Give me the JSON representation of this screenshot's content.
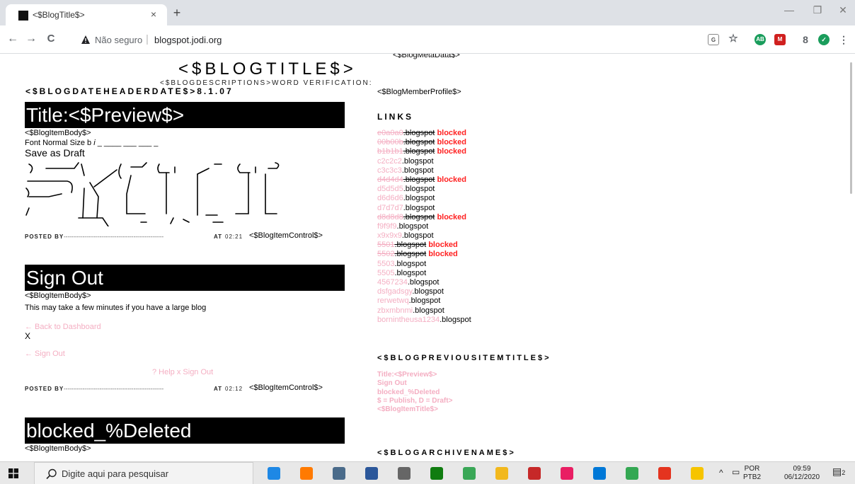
{
  "browser": {
    "tab_title": "<$BlogTitle$>",
    "tab_close": "×",
    "new_tab": "+",
    "window_min": "—",
    "window_restore": "❐",
    "window_close": "✕",
    "nav_back": "←",
    "nav_forward": "→",
    "nav_reload": "C",
    "security_label": "Não seguro",
    "url": "blogspot.jodi.org",
    "extensions": [
      {
        "name": "translate",
        "color": "#5f6368"
      },
      {
        "name": "bookmark-star",
        "color": "#5f6368"
      },
      {
        "name": "adblock",
        "color": "#1a9d5c",
        "label": "AB"
      },
      {
        "name": "red-extension",
        "color": "#d0201f"
      },
      {
        "name": "profile",
        "color": "#5f6368"
      },
      {
        "name": "shield",
        "color": "#1a9d5c"
      },
      {
        "name": "menu",
        "color": "#5f6368"
      }
    ]
  },
  "blog": {
    "meta_data": "<$BlogMetaData$>",
    "title": "<$BLOGTITLE$>",
    "description": "<$BLOGDESCRIPTIONS>WORD VERIFICATION:",
    "date_header": "<$BLOGDATEHEADERDATE$>8.1.07",
    "posts": [
      {
        "title": "Title:<$Preview$>",
        "body": "<$BlogItemBody$>",
        "font_line": "Font Normal Size b",
        "font_italic": "i",
        "font_underscores": " _ ____ ___ ___ _",
        "save_draft": "Save as Draft",
        "posted_by": "POSTED BY",
        "posted_dashes": "-----------------------------------------------------",
        "at": "AT",
        "time": "02:21",
        "control": "<$BlogItemControl$>"
      },
      {
        "title": "Sign Out",
        "body": "<$BlogItemBody$>",
        "text": "This may take a few minutes if you have a large blog",
        "back_link": "← Back to Dashboard",
        "x_mark": "X",
        "signout_link": "← Sign Out",
        "help_link": "? Help x Sign Out",
        "posted_by": "POSTED BY",
        "posted_dashes": "-----------------------------------------------------",
        "at": "AT",
        "time": "02:12",
        "control": "<$BlogItemControl$>"
      },
      {
        "title": "blocked_%Deleted",
        "body": "<$BlogItemBody$>"
      }
    ],
    "member_profile": "<$BlogMemberProfile$>",
    "links_heading": "LINKS",
    "links": [
      {
        "id": "e0a0a0",
        "suffix": ".blogspot",
        "blocked": "blocked"
      },
      {
        "id": "00b00b",
        "suffix": ".blogspot",
        "blocked": "blocked"
      },
      {
        "id": "b1b1b1",
        "suffix": ".blogspot",
        "blocked": "blocked"
      },
      {
        "id": "c2c2c2",
        "suffix": ".blogspot",
        "blocked": ""
      },
      {
        "id": "c3c3c3",
        "suffix": ".blogspot",
        "blocked": ""
      },
      {
        "id": "d4d4d4",
        "suffix": ".blogspot",
        "blocked": "blocked"
      },
      {
        "id": "d5d5d5",
        "suffix": ".blogspot",
        "blocked": ""
      },
      {
        "id": "d6d6d6",
        "suffix": ".blogspot",
        "blocked": ""
      },
      {
        "id": "d7d7d7",
        "suffix": ".blogspot",
        "blocked": ""
      },
      {
        "id": "d8d8d8",
        "suffix": ".blogspot",
        "blocked": "blocked"
      },
      {
        "id": "f9f9f9",
        "suffix": ".blogspot",
        "blocked": ""
      },
      {
        "id": "x9x9x9",
        "suffix": ".blogspot",
        "blocked": ""
      },
      {
        "id": "5501",
        "suffix": ".blogspot",
        "blocked": "blocked"
      },
      {
        "id": "5502",
        "suffix": ".blogspot",
        "blocked": "blocked"
      },
      {
        "id": "5503",
        "suffix": ".blogspot",
        "blocked": ""
      },
      {
        "id": "5505",
        "suffix": ".blogspot",
        "blocked": ""
      },
      {
        "id": "4567234",
        "suffix": ".blogspot",
        "blocked": ""
      },
      {
        "id": "dsfgadsgy",
        "suffix": ".blogspot",
        "blocked": ""
      },
      {
        "id": "rerwetwq",
        "suffix": ".blogspot",
        "blocked": ""
      },
      {
        "id": "zbxmbnmi",
        "suffix": ".blogspot",
        "blocked": ""
      },
      {
        "id": "bornintheusa1234",
        "suffix": ".blogspot",
        "blocked": ""
      }
    ],
    "previous_items_heading": "<$BLOGPREVIOUSITEMTITLE$>",
    "previous_items": [
      "Title:<$Preview$>",
      "Sign Out",
      "blocked_%Deleted",
      "$ = Publish, D = Draft>",
      "<$BlogItemTitle$>"
    ],
    "archive_heading": "<$BLOGARCHIVENAME$>"
  },
  "taskbar": {
    "search_placeholder": "Digite aqui para pesquisar",
    "apps": [
      {
        "name": "edge",
        "color": "#1e88e5"
      },
      {
        "name": "firefox",
        "color": "#ff7a00"
      },
      {
        "name": "calculator",
        "color": "#4a6b8a"
      },
      {
        "name": "word",
        "color": "#2b579a"
      },
      {
        "name": "file",
        "color": "#666666"
      },
      {
        "name": "xbox",
        "color": "#107c10"
      },
      {
        "name": "maps",
        "color": "#3aa757"
      },
      {
        "name": "explorer",
        "color": "#f2b81d"
      },
      {
        "name": "red-app",
        "color": "#c62828"
      },
      {
        "name": "paint",
        "color": "#e91e63"
      },
      {
        "name": "store",
        "color": "#0078d7"
      },
      {
        "name": "chrome",
        "color": "#34a853"
      },
      {
        "name": "acrobat",
        "color": "#e4341f"
      },
      {
        "name": "norton",
        "color": "#f6c400"
      }
    ],
    "lang": "POR",
    "layout": "PTB2",
    "time": "09:59",
    "date": "06/12/2020",
    "notification_count": "2"
  }
}
